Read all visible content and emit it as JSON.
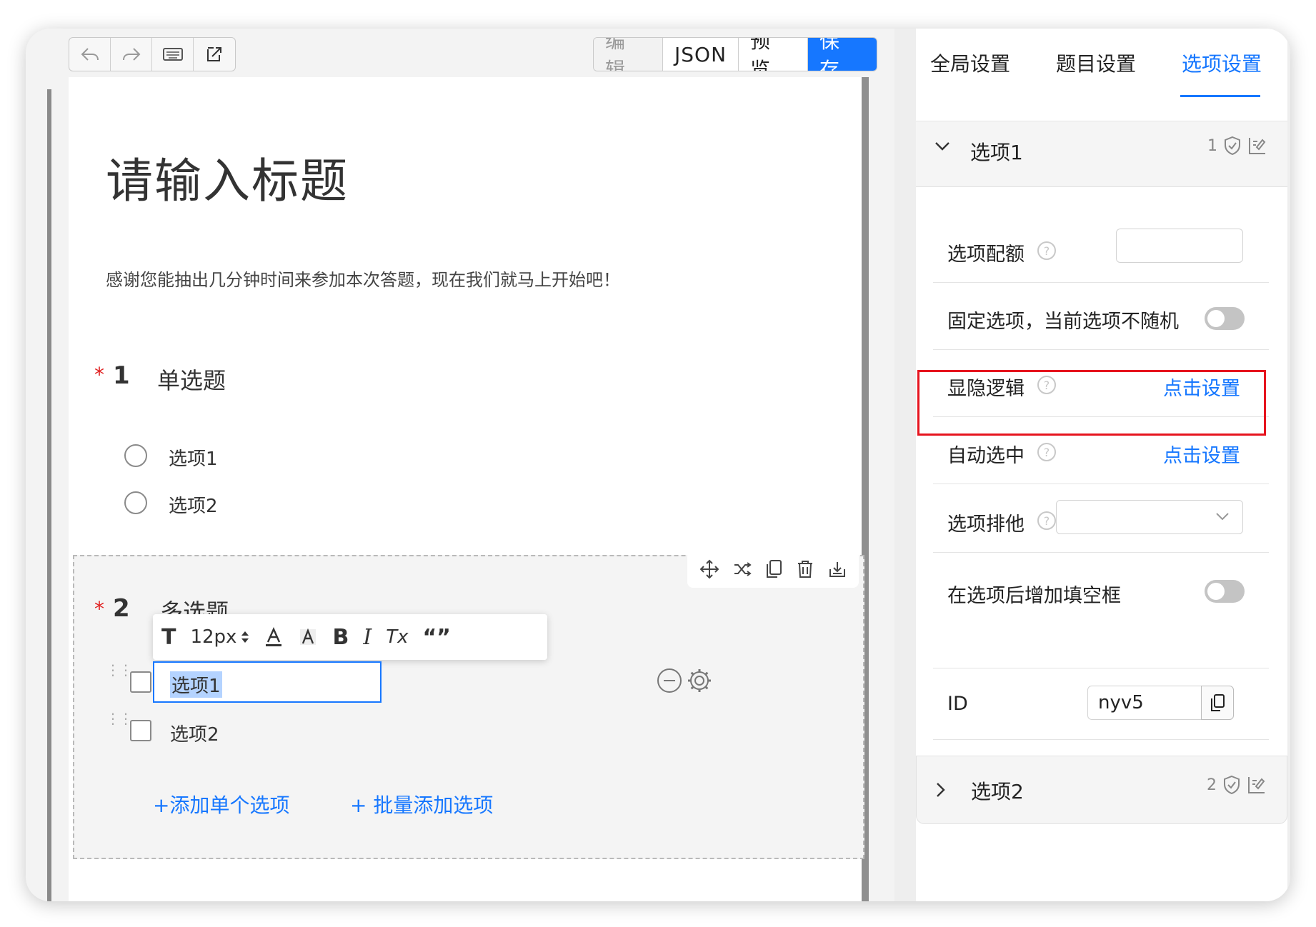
{
  "toolbar": {
    "undo_icon": "undo-icon",
    "redo_icon": "redo-icon",
    "keyboard_icon": "keyboard-icon",
    "export_icon": "export-icon",
    "edit_label": "编 辑",
    "json_label": "JSON",
    "preview_label": "预 览",
    "save_label": "保 存"
  },
  "survey": {
    "title": "请输入标题",
    "description": "感谢您能抽出几分钟时间来参加本次答题，现在我们就马上开始吧！",
    "questions": [
      {
        "required_mark": "*",
        "number": "1",
        "title": "单选题",
        "options": [
          "选项1",
          "选项2"
        ]
      },
      {
        "required_mark": "*",
        "number": "2",
        "title": "多选题",
        "options": [
          "选项1",
          "选项2"
        ],
        "add_single": "+添加单个选项",
        "add_batch": "+ 批量添加选项"
      }
    ]
  },
  "format_bar": {
    "text_icon": "T",
    "font_size": "12px",
    "bold": "B",
    "italic": "I",
    "clear": "Tx",
    "quote": "“”"
  },
  "panel": {
    "tabs": [
      "全局设置",
      "题目设置",
      "选项设置"
    ],
    "active_tab": "选项设置",
    "option1": {
      "title": "选项1",
      "index": "1",
      "rows": {
        "quota_label": "选项配额",
        "fixed_label": "固定选项，当前选项不随机",
        "visibility_label": "显隐逻辑",
        "visibility_action": "点击设置",
        "auto_select_label": "自动选中",
        "auto_select_action": "点击设置",
        "exclusive_label": "选项排他",
        "fill_blank_label": "在选项后增加填空框",
        "id_label": "ID",
        "id_value": "nyv5"
      }
    },
    "option2": {
      "title": "选项2",
      "index": "2"
    }
  },
  "colors": {
    "accent": "#1677ff",
    "required": "#e02020",
    "highlight_box": "#e6141e"
  }
}
